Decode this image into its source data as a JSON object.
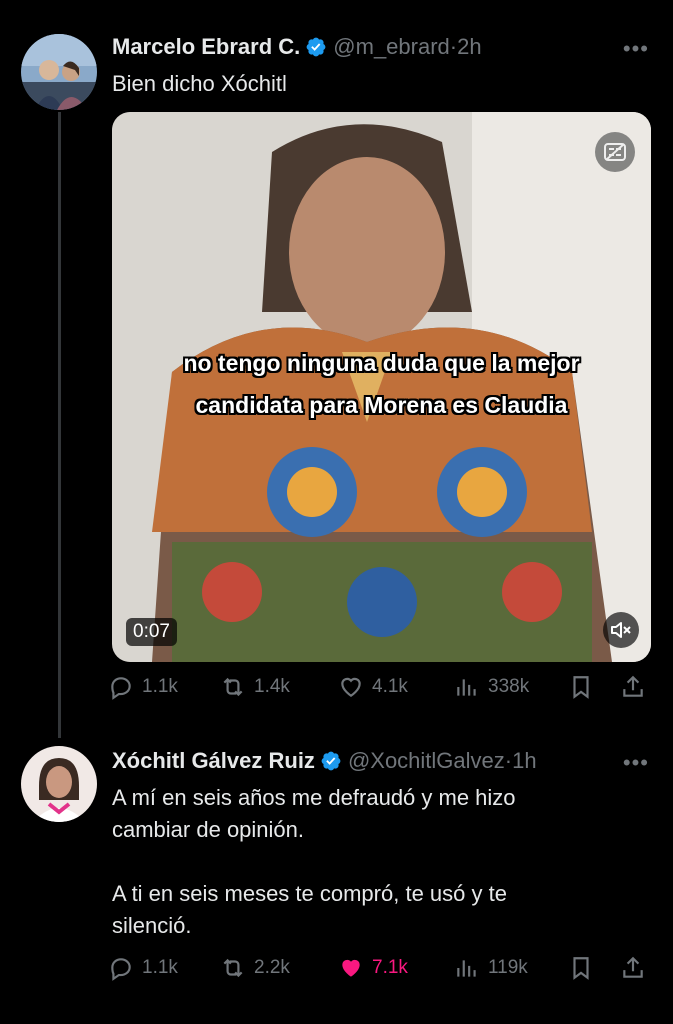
{
  "tweets": [
    {
      "name": "Marcelo Ebrard C.",
      "handle": "@m_ebrard",
      "separator": "·",
      "time": "2h",
      "text": "Bien dicho Xóchitl",
      "media": {
        "caption_line1": "no tengo ninguna duda que la mejor",
        "caption_line2": "candidata para Morena es Claudia",
        "duration": "0:07"
      },
      "stats": {
        "replies": "1.1k",
        "reposts": "1.4k",
        "likes": "4.1k",
        "views": "338k"
      }
    },
    {
      "name": "Xóchitl Gálvez Ruiz",
      "handle": "@XochitlGalvez",
      "separator": "·",
      "time": "1h",
      "text": "A mí en seis años me defraudó y me hizo\ncambiar de opinión.\n\nA ti en seis meses te compró, te usó y te\nsilenció.",
      "stats": {
        "replies": "1.1k",
        "reposts": "2.2k",
        "likes": "7.1k",
        "views": "119k"
      }
    }
  ],
  "more_label": "•••",
  "colors": {
    "background": "#000000",
    "text": "#e7e9ea",
    "secondary": "#71767b",
    "verified": "#1d9bf0",
    "like_active": "#f91880"
  }
}
